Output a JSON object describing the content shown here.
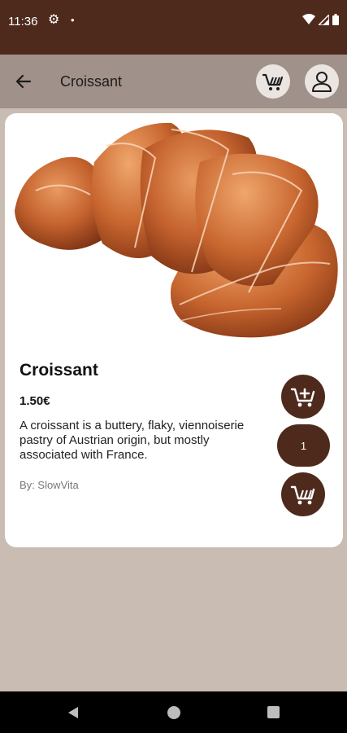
{
  "status_bar": {
    "time": "11:36",
    "gear_icon": "gear-icon",
    "dot": "•"
  },
  "app_bar": {
    "title": "Croissant",
    "icons": [
      "back-arrow-icon",
      "shopping-cart-icon",
      "account-icon"
    ]
  },
  "product": {
    "name": "Croissant",
    "price": "1.50€",
    "description": "A croissant is a buttery, flaky, viennoiserie pastry of Austrian origin, but mostly associated with France.",
    "author": "By: SlowVita",
    "quantity": "1",
    "icons": [
      "add-to-cart-icon",
      "remove-from-cart-icon"
    ]
  },
  "colors": {
    "primary": "#4e2a1c",
    "app_bar": "#a0918a",
    "background": "#c9bcb2",
    "card": "#ffffff"
  }
}
